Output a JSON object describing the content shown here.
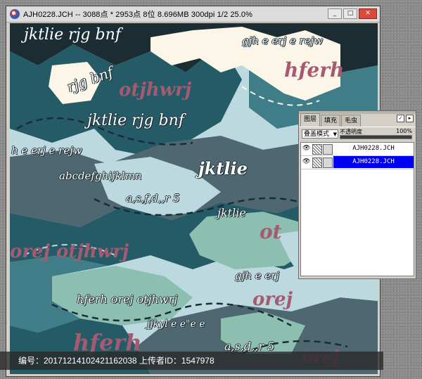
{
  "window": {
    "title": "AJH0228.JCH -- 3088点 * 2953点 8位  8.696MB 300dpi 1/2  25.0%",
    "buttons": [
      "_",
      "□",
      "✕"
    ]
  },
  "artwork_texts": {
    "t1": "jktlie  rjg bnf",
    "t2": "gjh e erj e rejw",
    "t3": "hferh",
    "t4": "rjg bnf",
    "t5": "otjhwrj",
    "t6": "jktlie  rjg bnf",
    "t7": "h e erj e rejw",
    "t8": "abcdefghijklmn",
    "t9": "jktlie",
    "t10": "a,s,f,d,,r 5",
    "t11": "jktlie",
    "t12": "orej otjhwrj",
    "t13": "ot",
    "t14": "gjh e erj",
    "t15": "hferh orej otjhwrj",
    "t16": "orej",
    "t17": "jjkyl e e\"e e",
    "t18": "hferh",
    "t19": "a,s,d,,r 5",
    "t20": "orej"
  },
  "statusbar": {
    "text": "编号：20171214102421162038 上传者ID：1547978"
  },
  "layers_panel": {
    "tabs": [
      "图层",
      "填充",
      "毛虫"
    ],
    "blend_mode": "叠盖模式",
    "opacity_label": "不透明度",
    "opacity_value": "100%",
    "opacity_fraction": 1.0,
    "layers": [
      {
        "name": "AJH0228.JCH",
        "selected": false
      },
      {
        "name": "AJH0228.JCH",
        "selected": true
      }
    ]
  },
  "colors": {
    "teal_dark": "#245b66",
    "teal_mid": "#3f7e88",
    "slate": "#4f6771",
    "light_blue": "#bcd9e0",
    "mint": "#8dbfb1",
    "cream": "#fbf6e7",
    "navy": "#1b2d33",
    "mauve": "#a55a71",
    "selection": "#0000f0"
  }
}
